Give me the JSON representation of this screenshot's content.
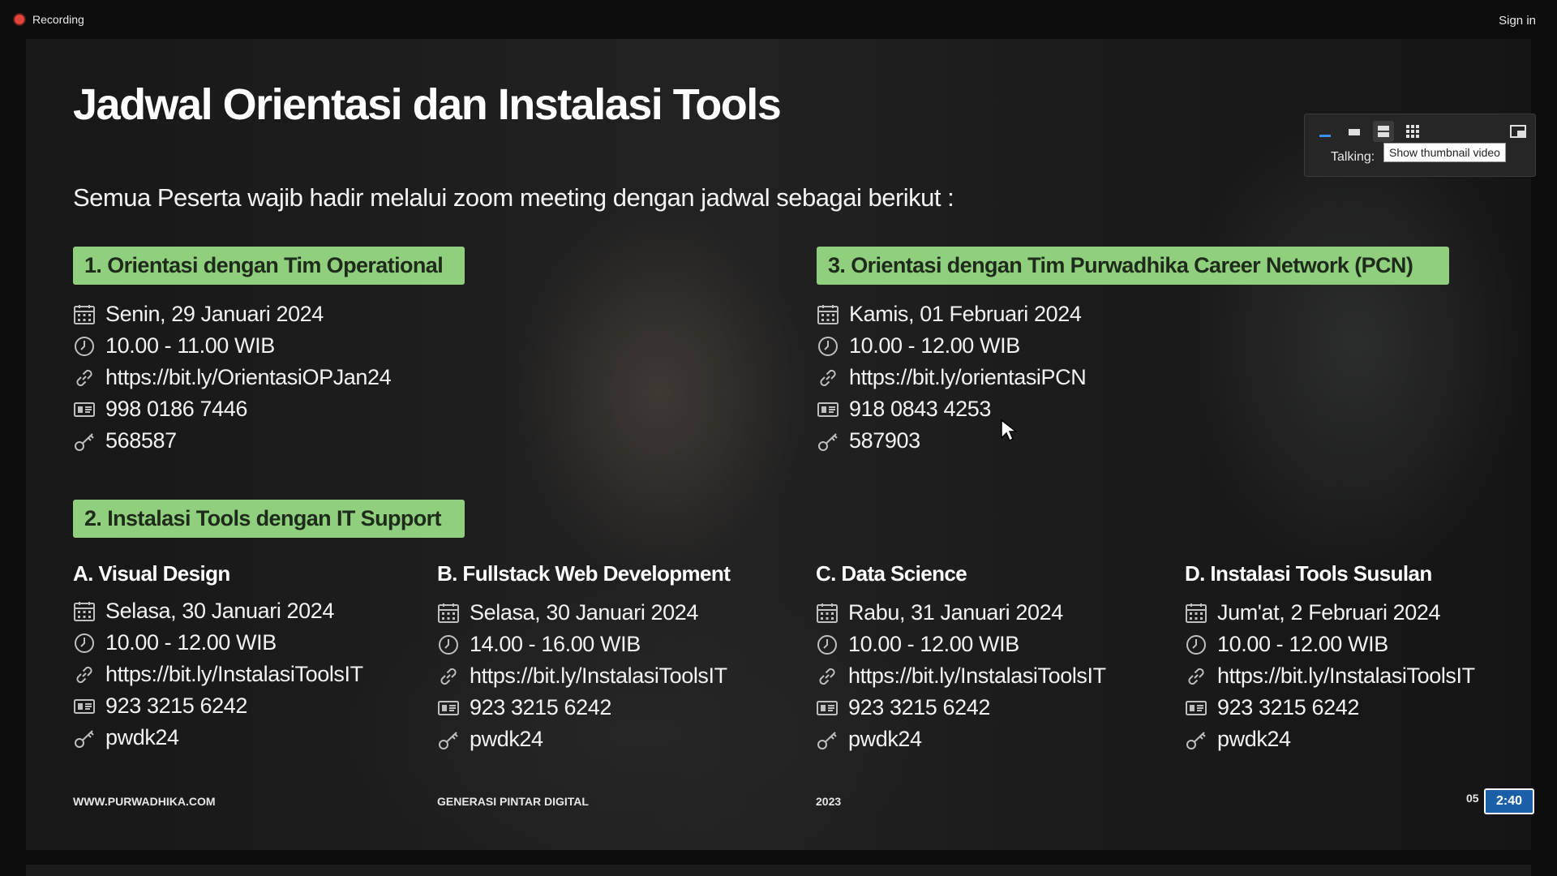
{
  "app": {
    "recording_label": "Recording",
    "signin_label": "Sign in"
  },
  "slide": {
    "title": "Jadwal Orientasi dan Instalasi Tools",
    "subtitle": "Semua Peserta wajib hadir melalui zoom meeting dengan jadwal sebagai berikut :",
    "section1": {
      "heading": "1. Orientasi dengan Tim Operational",
      "date": "Senin, 29 Januari 2024",
      "time": "10.00 - 11.00 WIB",
      "link": "https://bit.ly/OrientasiOPJan24",
      "meeting_id": "998 0186 7446",
      "passcode": "568587"
    },
    "section3": {
      "heading": "3. Orientasi dengan Tim Purwadhika Career Network (PCN)",
      "date": "Kamis, 01 Februari 2024",
      "time": "10.00 - 12.00 WIB",
      "link": "https://bit.ly/orientasiPCN",
      "meeting_id": "918 0843 4253",
      "passcode": "587903"
    },
    "section2": {
      "heading": "2. Instalasi Tools dengan IT Support",
      "tracks": [
        {
          "title": "A. Visual Design",
          "date": "Selasa, 30 Januari 2024",
          "time": "10.00 - 12.00 WIB",
          "link": "https://bit.ly/InstalasiToolsIT",
          "meeting_id": "923 3215 6242",
          "passcode": "pwdk24"
        },
        {
          "title": "B. Fullstack Web Development",
          "date": "Selasa, 30 Januari 2024",
          "time": "14.00 - 16.00 WIB",
          "link": "https://bit.ly/InstalasiToolsIT",
          "meeting_id": "923 3215 6242",
          "passcode": "pwdk24"
        },
        {
          "title": "C. Data Science",
          "date": "Rabu, 31 Januari 2024",
          "time": "10.00 - 12.00 WIB",
          "link": "https://bit.ly/InstalasiToolsIT",
          "meeting_id": "923 3215 6242",
          "passcode": "pwdk24"
        },
        {
          "title": "D. Instalasi Tools Susulan",
          "date": "Jum'at, 2 Februari 2024",
          "time": "10.00 - 12.00 WIB",
          "link": "https://bit.ly/InstalasiToolsIT",
          "meeting_id": "923 3215 6242",
          "passcode": "pwdk24"
        }
      ]
    },
    "footer": {
      "website": "WWW.PURWADHIKA.COM",
      "tagline": "GENERASI PINTAR DIGITAL",
      "year": "2023",
      "page_prefix": "05"
    }
  },
  "video_panel": {
    "talking_label": "Talking:",
    "tooltip": "Show thumbnail video"
  },
  "timer": {
    "value": "2:40"
  },
  "colors": {
    "pill_green": "#8fcf7e",
    "record_red": "#e0443a",
    "timer_blue": "#1a5fa8"
  },
  "icons": [
    "calendar-icon",
    "clock-icon",
    "link-icon",
    "id-card-icon",
    "key-icon"
  ]
}
